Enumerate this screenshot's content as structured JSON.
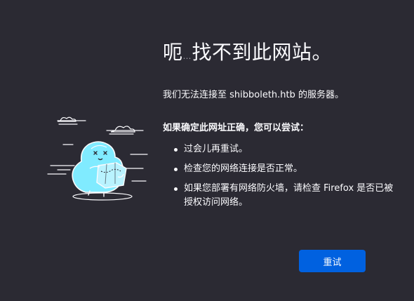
{
  "error": {
    "title_main": "呃",
    "title_dots": "…",
    "title_rest": "找不到此网站。",
    "description": "我们无法连接至 shibboleth.htb 的服务器。",
    "suggestions_heading": "如果确定此网址正确，您可以尝试：",
    "suggestions": [
      "过会儿再重试。",
      "检查您的网络连接是否正常。",
      "如果您部署有网络防火墙，请检查 Firefox 是否已被授权访问网络。"
    ]
  },
  "buttons": {
    "retry_label": "重试"
  },
  "colors": {
    "background": "#2b2a33",
    "text": "#fbfbfe",
    "accent": "#0061e0",
    "illustration_outline": "#ffffff",
    "illustration_fill": "#80ebff"
  },
  "illustration": {
    "icon": "confused-dino-icon"
  }
}
